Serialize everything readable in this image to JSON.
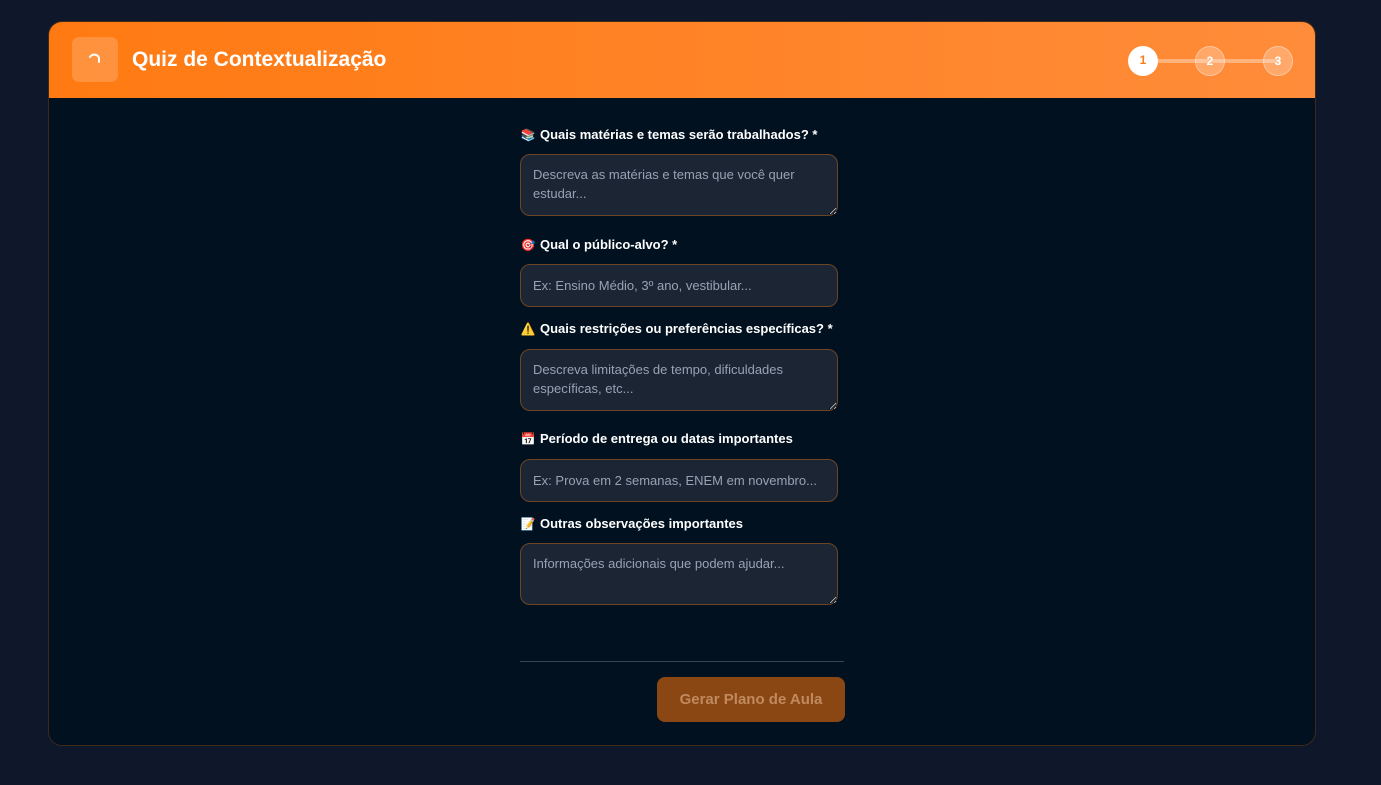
{
  "header": {
    "title": "Quiz de Contextualização",
    "logo_icon": "loading-spinner-icon",
    "steps": [
      {
        "label": "1",
        "state": "active"
      },
      {
        "label": "2",
        "state": "inactive"
      },
      {
        "label": "3",
        "state": "inactive"
      }
    ]
  },
  "form": {
    "subjects": {
      "emoji": "📚",
      "label": "Quais matérias e temas serão trabalhados? *",
      "placeholder": "Descreva as matérias e temas que você quer estudar...",
      "value": ""
    },
    "audience": {
      "emoji": "🎯",
      "label": "Qual o público-alvo? *",
      "placeholder": "Ex: Ensino Médio, 3º ano, vestibular...",
      "value": ""
    },
    "restrictions": {
      "emoji": "⚠️",
      "label": "Quais restrições ou preferências específicas? *",
      "placeholder": "Descreva limitações de tempo, dificuldades específicas, etc...",
      "value": ""
    },
    "deadline": {
      "emoji": "📅",
      "label": "Período de entrega ou datas importantes",
      "placeholder": "Ex: Prova em 2 semanas, ENEM em novembro...",
      "value": ""
    },
    "notes": {
      "emoji": "📝",
      "label": "Outras observações importantes",
      "placeholder": "Informações adicionais que podem ajudar...",
      "value": ""
    }
  },
  "actions": {
    "submit_label": "Gerar Plano de Aula",
    "submit_enabled": false
  },
  "colors": {
    "header_gradient_start": "#ff7a12",
    "header_gradient_end": "#ff8c3a",
    "field_border": "#6b4525",
    "button_disabled_bg": "#8a4714",
    "page_bg": "#0f172a"
  }
}
